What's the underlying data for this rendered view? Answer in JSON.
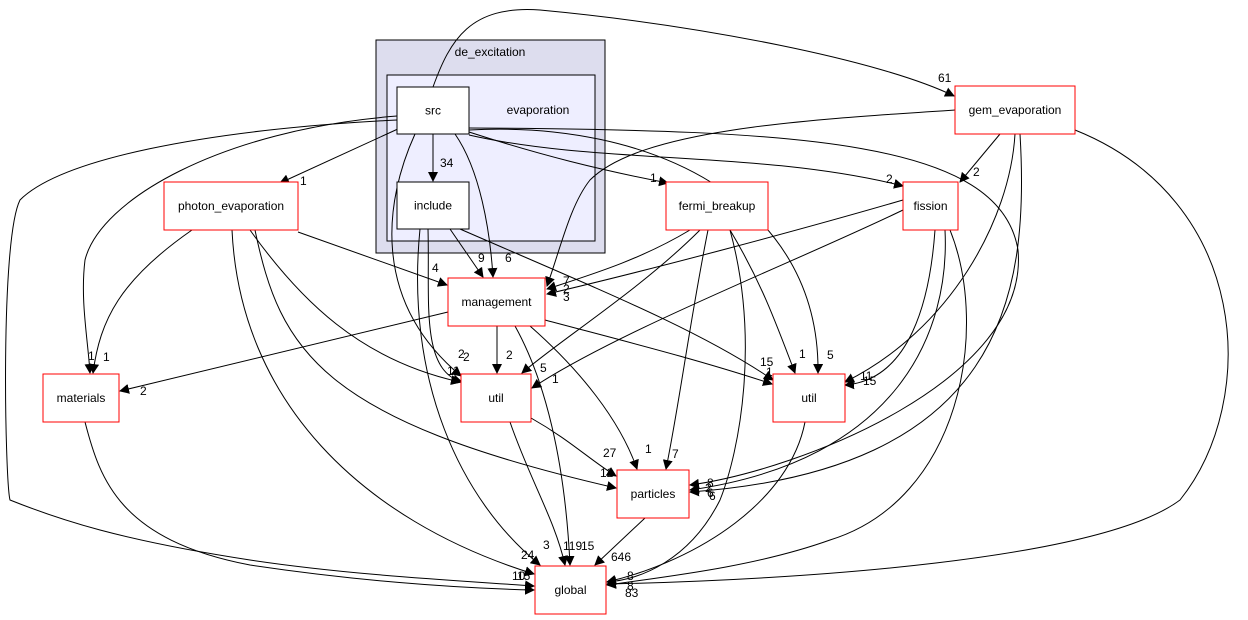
{
  "clusters": [
    {
      "id": "de_excitation",
      "label": "de_excitation",
      "fill": "#ddddee"
    },
    {
      "id": "evaporation",
      "label": "evaporation",
      "fill": "#eeeeff"
    }
  ],
  "nodes": [
    {
      "id": "src",
      "label": "src",
      "border": "#000000"
    },
    {
      "id": "include",
      "label": "include",
      "border": "#000000"
    },
    {
      "id": "gem_evaporation",
      "label": "gem_evaporation",
      "border": "#ff0000"
    },
    {
      "id": "photon_evaporation",
      "label": "photon_evaporation",
      "border": "#ff0000"
    },
    {
      "id": "fermi_breakup",
      "label": "fermi_breakup",
      "border": "#ff0000"
    },
    {
      "id": "fission",
      "label": "fission",
      "border": "#ff0000"
    },
    {
      "id": "management",
      "label": "management",
      "border": "#ff0000"
    },
    {
      "id": "materials",
      "label": "materials",
      "border": "#ff0000"
    },
    {
      "id": "util_left",
      "label": "util",
      "border": "#ff0000"
    },
    {
      "id": "util_right",
      "label": "util",
      "border": "#ff0000"
    },
    {
      "id": "particles",
      "label": "particles",
      "border": "#ff0000"
    },
    {
      "id": "global",
      "label": "global",
      "border": "#ff0000"
    }
  ],
  "edges": [
    {
      "from": "src",
      "to": "gem_evaporation",
      "label": "61"
    },
    {
      "from": "src",
      "to": "include",
      "label": "34"
    },
    {
      "from": "src",
      "to": "photon_evaporation",
      "label": "1"
    },
    {
      "from": "src",
      "to": "materials",
      "label": "1"
    },
    {
      "from": "src",
      "to": "global",
      "label": "10"
    },
    {
      "from": "src",
      "to": "management",
      "label": "6"
    },
    {
      "from": "src",
      "to": "util_left",
      "label": "2"
    },
    {
      "from": "src",
      "to": "fermi_breakup",
      "label": "1"
    },
    {
      "from": "src",
      "to": "fission",
      "label": "2"
    },
    {
      "from": "src",
      "to": "util_right",
      "label": "5"
    },
    {
      "from": "src",
      "to": "particles",
      "label": "2"
    },
    {
      "from": "gem_evaporation",
      "to": "management",
      "label": "7"
    },
    {
      "from": "gem_evaporation",
      "to": "fission",
      "label": "2"
    },
    {
      "from": "gem_evaporation",
      "to": "util_right",
      "label": "11"
    },
    {
      "from": "gem_evaporation",
      "to": "particles",
      "label": "6"
    },
    {
      "from": "gem_evaporation",
      "to": "global",
      "label": "83"
    },
    {
      "from": "photon_evaporation",
      "to": "management",
      "label": "4"
    },
    {
      "from": "photon_evaporation",
      "to": "materials",
      "label": "1"
    },
    {
      "from": "photon_evaporation",
      "to": "util_left",
      "label": "11"
    },
    {
      "from": "photon_evaporation",
      "to": "particles",
      "label": "12"
    },
    {
      "from": "photon_evaporation",
      "to": "global",
      "label": "24"
    },
    {
      "from": "include",
      "to": "management",
      "label": "9"
    },
    {
      "from": "include",
      "to": "util_left",
      "label": "2"
    },
    {
      "from": "include",
      "to": "util_right",
      "label": "15"
    },
    {
      "from": "include",
      "to": "global",
      "label": "3"
    },
    {
      "from": "fermi_breakup",
      "to": "management",
      "label": "2"
    },
    {
      "from": "fermi_breakup",
      "to": "util_left",
      "label": "5"
    },
    {
      "from": "fermi_breakup",
      "to": "particles",
      "label": "7"
    },
    {
      "from": "fermi_breakup",
      "to": "util_right",
      "label": "1"
    },
    {
      "from": "fermi_breakup",
      "to": "global",
      "label": "6"
    },
    {
      "from": "fission",
      "to": "management",
      "label": "3"
    },
    {
      "from": "fission",
      "to": "util_left",
      "label": "1"
    },
    {
      "from": "fission",
      "to": "util_right",
      "label": "15"
    },
    {
      "from": "fission",
      "to": "particles",
      "label": "8"
    },
    {
      "from": "fission",
      "to": "global",
      "label": "8"
    },
    {
      "from": "management",
      "to": "materials",
      "label": "2"
    },
    {
      "from": "management",
      "to": "util_left",
      "label": "2"
    },
    {
      "from": "management",
      "to": "util_right",
      "label": "1"
    },
    {
      "from": "management",
      "to": "particles",
      "label": "1"
    },
    {
      "from": "management",
      "to": "global",
      "label": "119"
    },
    {
      "from": "util_left",
      "to": "particles",
      "label": "27"
    },
    {
      "from": "util_left",
      "to": "global",
      "label": "15"
    },
    {
      "from": "util_right",
      "to": "global",
      "label": "8"
    },
    {
      "from": "particles",
      "to": "global",
      "label": "646"
    },
    {
      "from": "materials",
      "to": "global",
      "label": "15"
    }
  ]
}
